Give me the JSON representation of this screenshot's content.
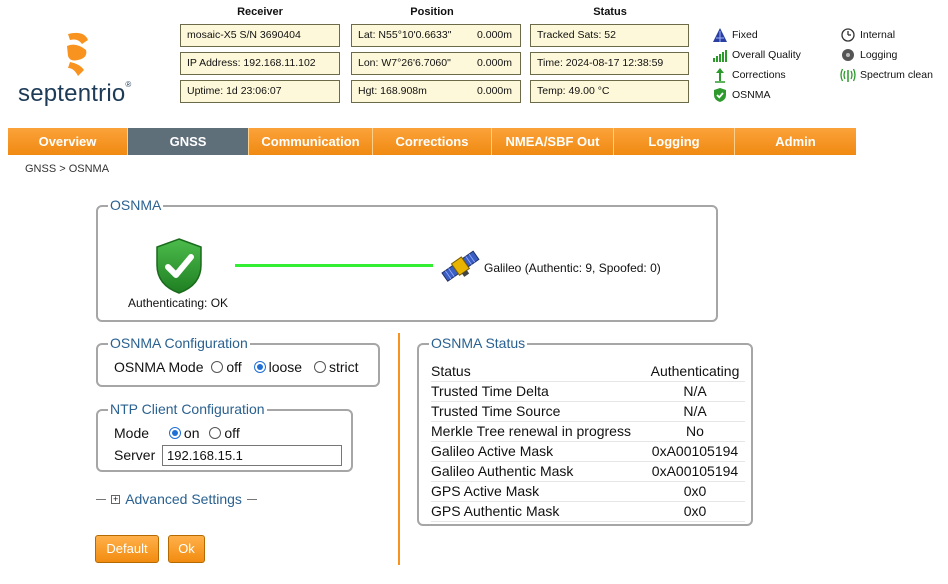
{
  "brand": {
    "name": "septentrio",
    "reg": "®"
  },
  "receiver": {
    "heading": "Receiver",
    "model": "mosaic-X5 S/N 3690404",
    "ip": "IP Address: 192.168.11.102",
    "uptime": "Uptime: 1d 23:06:07"
  },
  "position": {
    "heading": "Position",
    "lat": "Lat:  N55°10'0.6633\"",
    "lat_err": "0.000m",
    "lon": "Lon: W7°26'6.7060\"",
    "lon_err": "0.000m",
    "hgt": "Hgt: 168.908m",
    "hgt_err": "0.000m"
  },
  "status": {
    "heading": "Status",
    "tracked": "Tracked Sats: 52",
    "time": "Time: 2024-08-17 12:38:59",
    "temp": "Temp: 49.00 °C"
  },
  "legend": {
    "fixed": "Fixed",
    "quality": "Overall Quality",
    "corrections": "Corrections",
    "osnma": "OSNMA",
    "internal": "Internal",
    "logging": "Logging",
    "spectrum": "Spectrum clean"
  },
  "nav": {
    "overview": "Overview",
    "gnss": "GNSS",
    "communication": "Communication",
    "corrections": "Corrections",
    "nmea": "NMEA/SBF Out",
    "logging": "Logging",
    "admin": "Admin"
  },
  "breadcrumb": "GNSS > OSNMA",
  "osnma_panel": {
    "legend": "OSNMA",
    "auth_status": "Authenticating: OK",
    "galileo_label": "Galileo (Authentic: 9, Spoofed: 0)"
  },
  "config": {
    "legend": "OSNMA Configuration",
    "mode_label": "OSNMA Mode",
    "opt_off": "off",
    "opt_loose": "loose",
    "opt_strict": "strict",
    "selected": "loose"
  },
  "ntp": {
    "legend": "NTP Client Configuration",
    "mode_label": "Mode",
    "opt_on": "on",
    "opt_off": "off",
    "selected": "on",
    "server_label": "Server",
    "server_value": "192.168.15.1"
  },
  "advanced": {
    "label": "Advanced Settings",
    "toggle": "+"
  },
  "osnma_status": {
    "legend": "OSNMA Status",
    "rows": [
      {
        "label": "Status",
        "value": "Authenticating"
      },
      {
        "label": "Trusted Time Delta",
        "value": "N/A"
      },
      {
        "label": "Trusted Time Source",
        "value": "N/A"
      },
      {
        "label": "Merkle Tree renewal in progress",
        "value": "No"
      },
      {
        "label": "Galileo Active Mask",
        "value": "0xA00105194"
      },
      {
        "label": "Galileo Authentic Mask",
        "value": "0xA00105194"
      },
      {
        "label": "GPS Active Mask",
        "value": "0x0"
      },
      {
        "label": "GPS Authentic Mask",
        "value": "0x0"
      }
    ]
  },
  "buttons": {
    "default": "Default",
    "ok": "Ok"
  },
  "colors": {
    "brand_orange": "#f7931e",
    "nav_active": "#5f6f7a",
    "info_box_bg": "#fdf8d9",
    "link_blue": "#2a6190",
    "auth_green": "#2e9a2e",
    "link_line_green": "#33ee33"
  }
}
